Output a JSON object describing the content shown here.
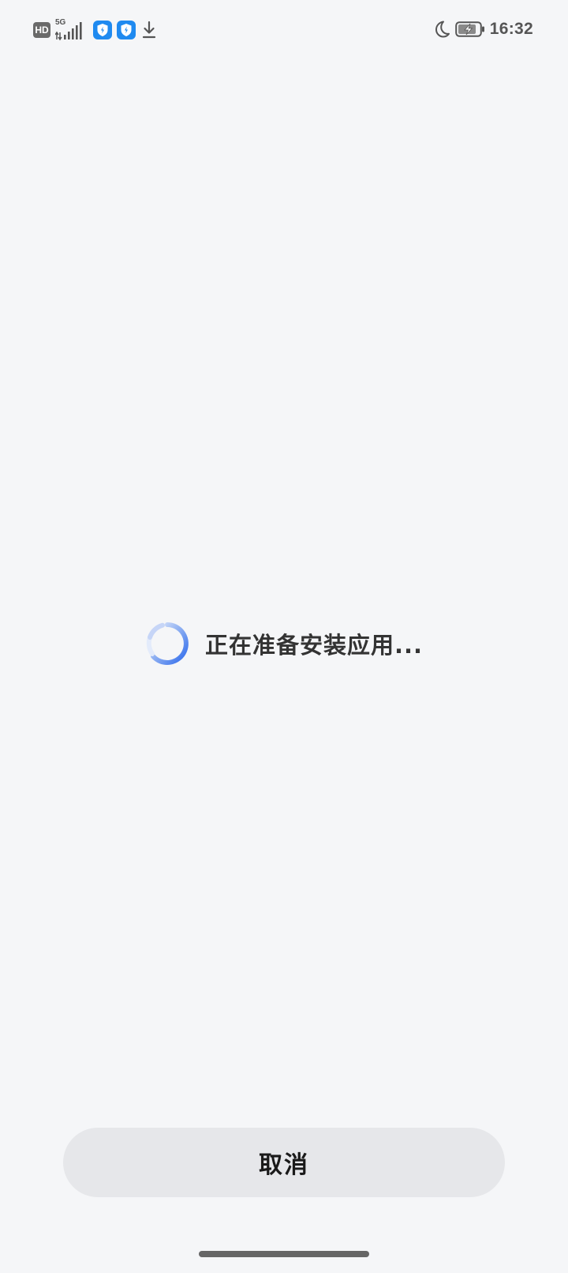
{
  "status_bar": {
    "hd_label": "HD",
    "network_label": "5G",
    "time": "16:32",
    "icons": [
      "hd-icon",
      "signal-icon",
      "app-shield-icon",
      "app-shield-icon",
      "download-icon",
      "moon-icon",
      "battery-charging-icon"
    ]
  },
  "installer": {
    "status_text": "正在准备安装应用...",
    "cancel_label": "取消"
  },
  "colors": {
    "background": "#f5f6f8",
    "accent": "#2f6bec",
    "button_bg": "#e6e7ea",
    "app_icon": "#1f8af0"
  }
}
